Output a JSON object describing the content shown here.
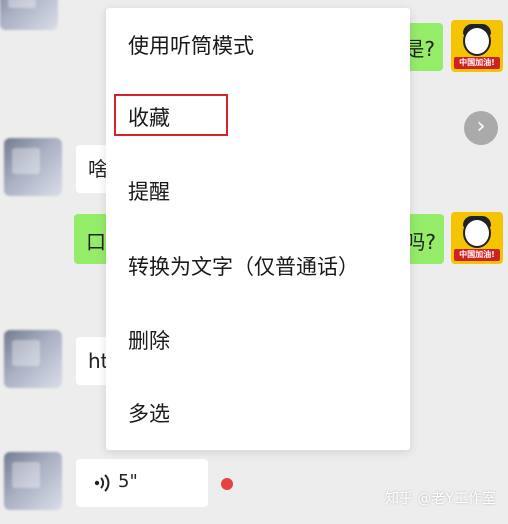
{
  "chat": {
    "bubble_1_right_tail": "是?",
    "bubble_2_left": "啥",
    "bubble_3_right_head": "口",
    "bubble_3_right_tail": "吗?",
    "bubble_4_left": "ht",
    "voice_duration": "5\"",
    "avatar_badge_text": "中国加油!"
  },
  "context_menu": {
    "items": [
      {
        "label": "使用听筒模式"
      },
      {
        "label": "收藏"
      },
      {
        "label": "提醒"
      },
      {
        "label": "转换为文字（仅普通话）"
      },
      {
        "label": "删除"
      },
      {
        "label": "多选"
      }
    ],
    "highlighted_index": 1
  },
  "watermark": "知乎 @老Y工作室",
  "colors": {
    "background": "#ededed",
    "green_bubble": "#95ec69",
    "highlight_border": "#d8212a",
    "unread_dot": "#e64340",
    "avatar_yellow": "#f5c400"
  },
  "icons": {
    "voice": "voice-wave-icon",
    "next": "chevron-right-icon"
  }
}
